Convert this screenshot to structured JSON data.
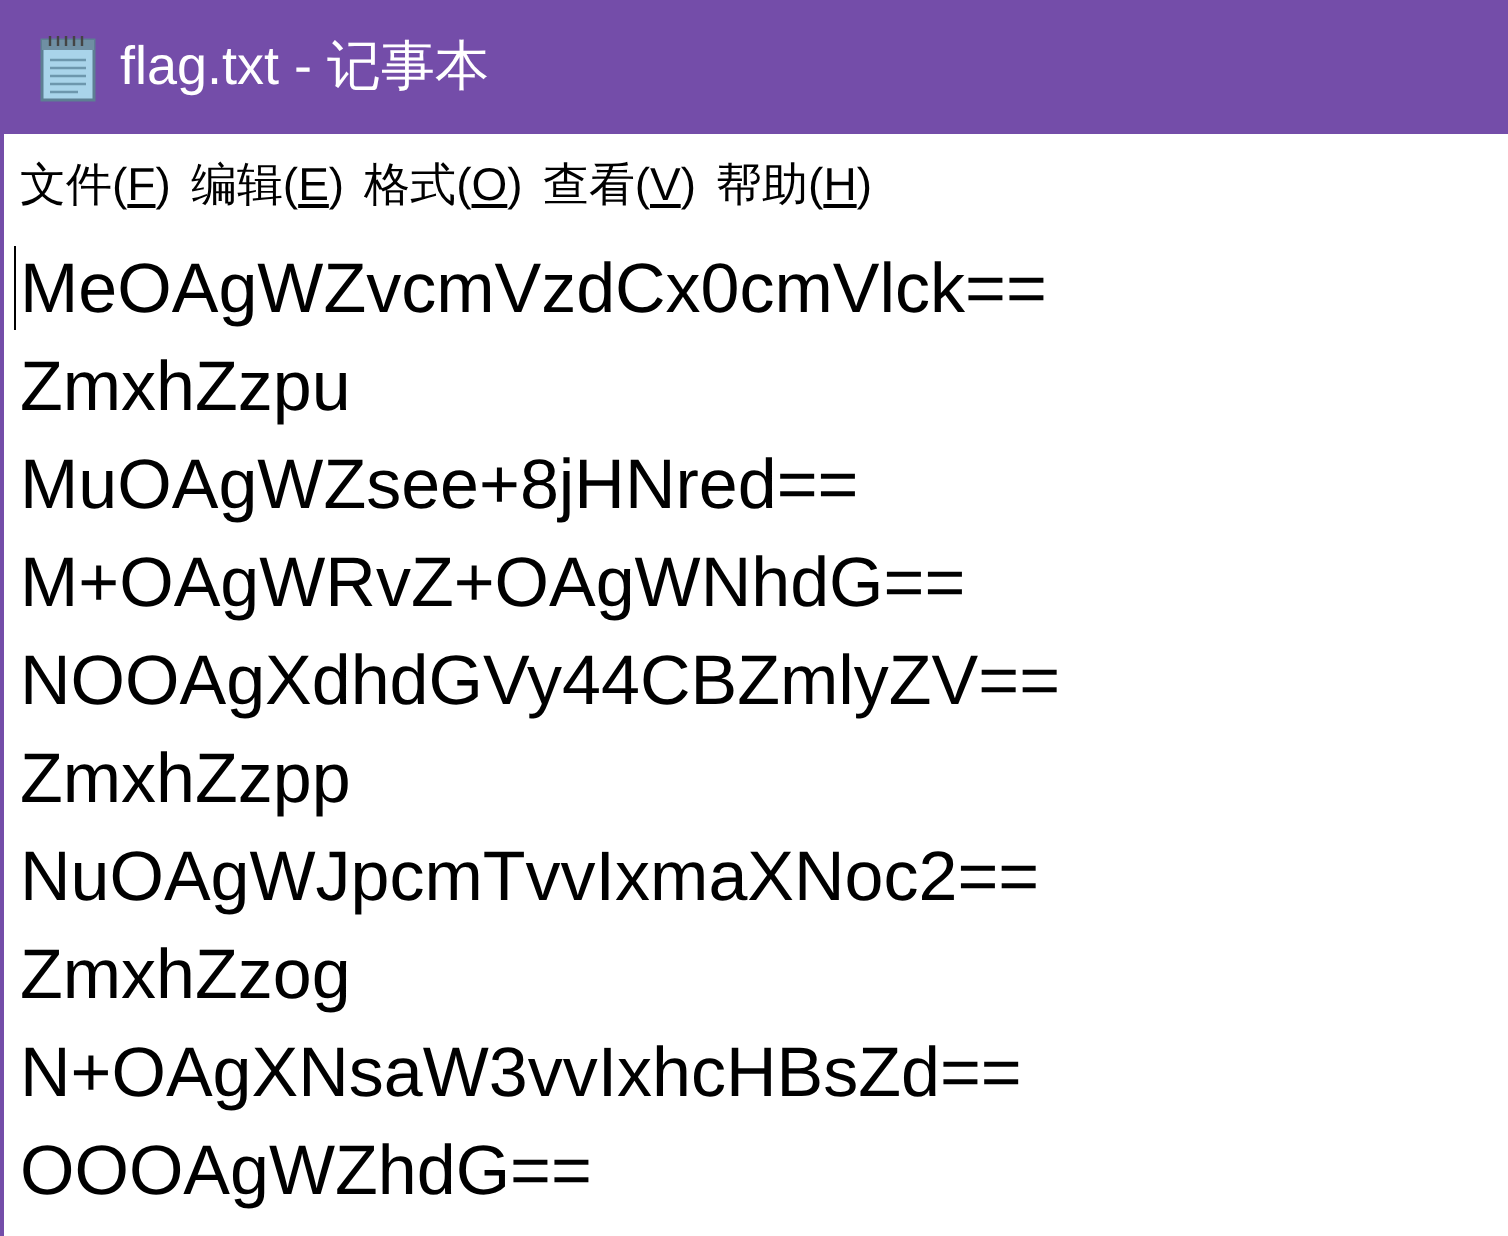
{
  "window": {
    "title": "flag.txt - 记事本"
  },
  "menu": [
    {
      "before": "文件(",
      "key": "F",
      "after": ")"
    },
    {
      "before": "编辑(",
      "key": "E",
      "after": ")"
    },
    {
      "before": "格式(",
      "key": "O",
      "after": ")"
    },
    {
      "before": "查看(",
      "key": "V",
      "after": ")"
    },
    {
      "before": "帮助(",
      "key": "H",
      "after": ")"
    }
  ],
  "editor": {
    "lines": [
      "MeOAgWZvcmVzdCx0cmVlck==",
      "ZmxhZzpu",
      "MuOAgWZsee+8jHNred==",
      "M+OAgWRvZ+OAgWNhdG==",
      "NOOAgXdhdGVy44CBZmlyZV==",
      "ZmxhZzpp",
      "NuOAgWJpcmTvvIxmaXNoc2==",
      "ZmxhZzog",
      "N+OAgXNsaW3vvIxhcHBsZd==",
      "OOOAgWZhdG=="
    ]
  }
}
